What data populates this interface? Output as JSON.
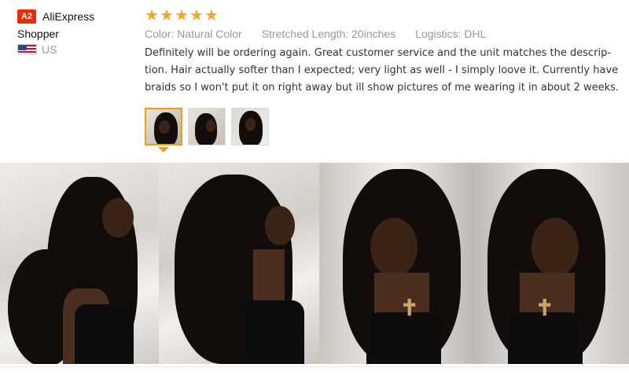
{
  "reviewer": {
    "badge": "A2",
    "name_line1": "AliExpress",
    "name_line2": "Shopper",
    "country": "US"
  },
  "review": {
    "rating": 5,
    "star_color": "#f5a623",
    "attributes": [
      "Color: Natural Color",
      "Stretched Length: 20inches",
      "Logistics: DHL"
    ],
    "text": "Definitely will be ordering again. Great customer service and the unit matches the descrip-tion. Hair actually softer than I expected; very light as well - I simply loove it. Currently have braids so I won't put it on right away but ill show pictures of me wearing it in about 2 weeks."
  },
  "thumbnails": {
    "count": 3,
    "selected_index": 0
  }
}
